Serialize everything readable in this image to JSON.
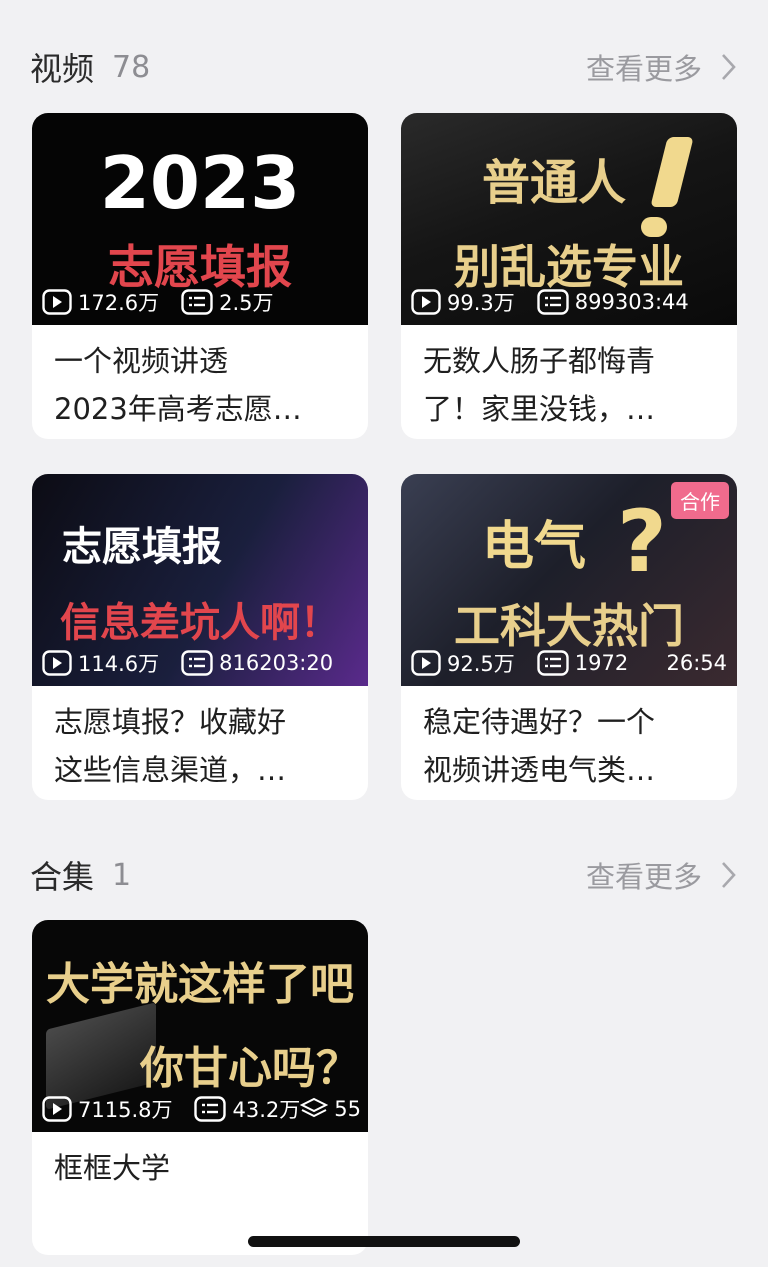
{
  "videos_section": {
    "title": "视频",
    "count": "78",
    "more_label": "查看更多",
    "cards": [
      {
        "thumb_line1": "2023",
        "thumb_line2": "志愿填报",
        "views": "172.6万",
        "danmaku": "2.5万",
        "duration": "",
        "caption_line1": "一个视频讲透",
        "caption_line2": "2023年高考志愿…"
      },
      {
        "thumb_line1": "普通人",
        "thumb_line2": "别乱选专业",
        "views": "99.3万",
        "danmaku": "8993",
        "duration": "03:44",
        "caption_line1": "无数人肠子都悔青",
        "caption_line2": "了！家里没钱，…"
      },
      {
        "thumb_line1": "志愿填报",
        "thumb_line2": "信息差坑人啊！",
        "views": "114.6万",
        "danmaku": "8162",
        "duration": "03:20",
        "caption_line1": "志愿填报？收藏好",
        "caption_line2": "这些信息渠道，…"
      },
      {
        "thumb_line1": "电气",
        "thumb_line2": "工科大热门",
        "views": "92.5万",
        "danmaku": "1972",
        "duration": "26:54",
        "badge": "合作",
        "caption_line1": "稳定待遇好？一个",
        "caption_line2": "视频讲透电气类…"
      }
    ]
  },
  "collections_section": {
    "title": "合集",
    "count": "1",
    "more_label": "查看更多",
    "card": {
      "thumb_line1": "大学就这样了吧",
      "thumb_line2": "你甘心吗？",
      "views": "7115.8万",
      "danmaku": "43.2万",
      "episodes": "55",
      "caption": "框框大学"
    }
  },
  "colors": {
    "background": "#f1f1f3",
    "thumb_red": "#e2464d",
    "thumb_gold": "#e8cf8c",
    "badge_pink": "#f06b8d"
  },
  "icons": [
    "play-icon",
    "danmaku-icon",
    "chevron-right-icon",
    "stack-icon"
  ]
}
